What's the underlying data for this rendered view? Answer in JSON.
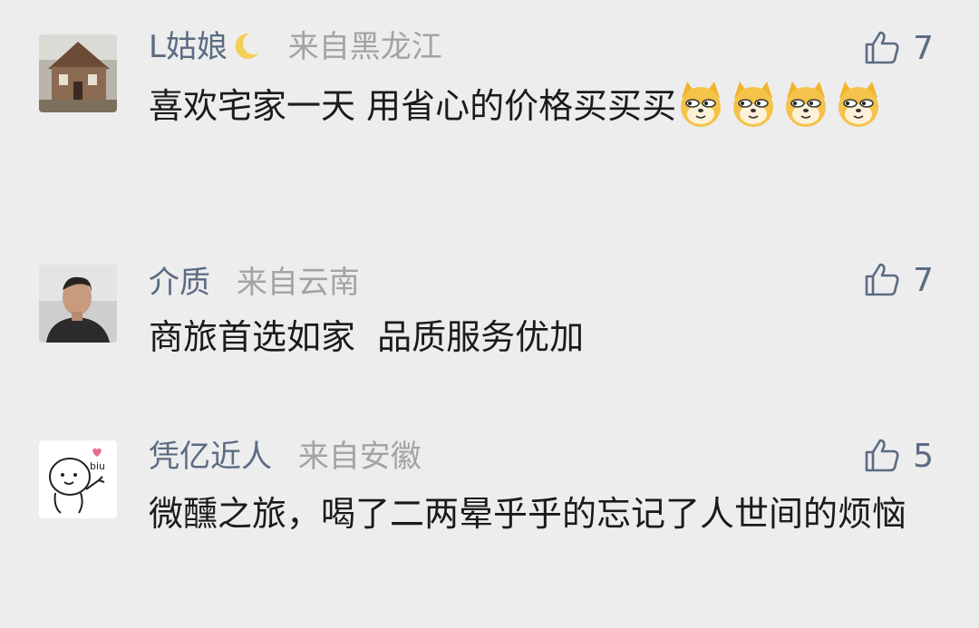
{
  "comments": [
    {
      "username": "L姑娘",
      "username_emoji": "crescent-moon-icon",
      "location": "来自黑龙江",
      "likes": "7",
      "text": "喜欢宅家一天 用省心的价格买买买",
      "trailing_emoji": [
        "doge-icon",
        "doge-icon",
        "doge-icon",
        "doge-icon"
      ],
      "avatar": "cabin-photo-avatar"
    },
    {
      "username": "介质",
      "location": "来自云南",
      "likes": "7",
      "text": "商旅首选如家  品质服务优加",
      "avatar": "man-photo-avatar"
    },
    {
      "username": "凭亿近人",
      "location": "来自安徽",
      "likes": "5",
      "text": "微醺之旅，喝了二两晕乎乎的忘记了人世间的烦恼",
      "avatar": "doodle-biu-avatar",
      "avatar_text": "biu"
    }
  ],
  "colors": {
    "background": "#ededed",
    "username": "#5b6b83",
    "location": "#a3a3a3",
    "text": "#1b1b1b",
    "like": "#5b6b83"
  }
}
